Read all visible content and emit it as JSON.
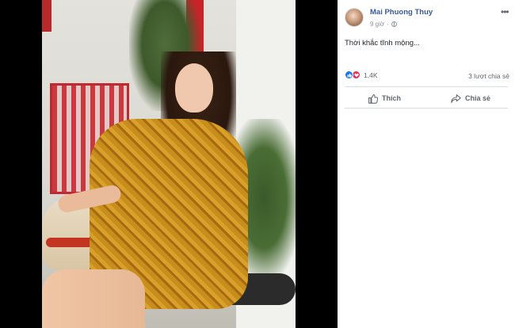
{
  "post": {
    "author": "Mai Phuong Thuy",
    "time": "9 giờ",
    "privacy_icon": "globe-icon",
    "caption": "Thời khắc tĩnh mộng...",
    "reactions": {
      "icons": [
        "like-icon",
        "love-icon"
      ],
      "count": "1,4K"
    },
    "shares": "3 lượt chia sẻ",
    "actions": {
      "like_label": "Thích",
      "share_label": "Chia sẻ"
    }
  },
  "photo": {
    "subject": "photo"
  },
  "colors": {
    "author_link": "#385898",
    "like_blue": "#1877f2",
    "love_red": "#f0284a",
    "muted_text": "#606770"
  }
}
